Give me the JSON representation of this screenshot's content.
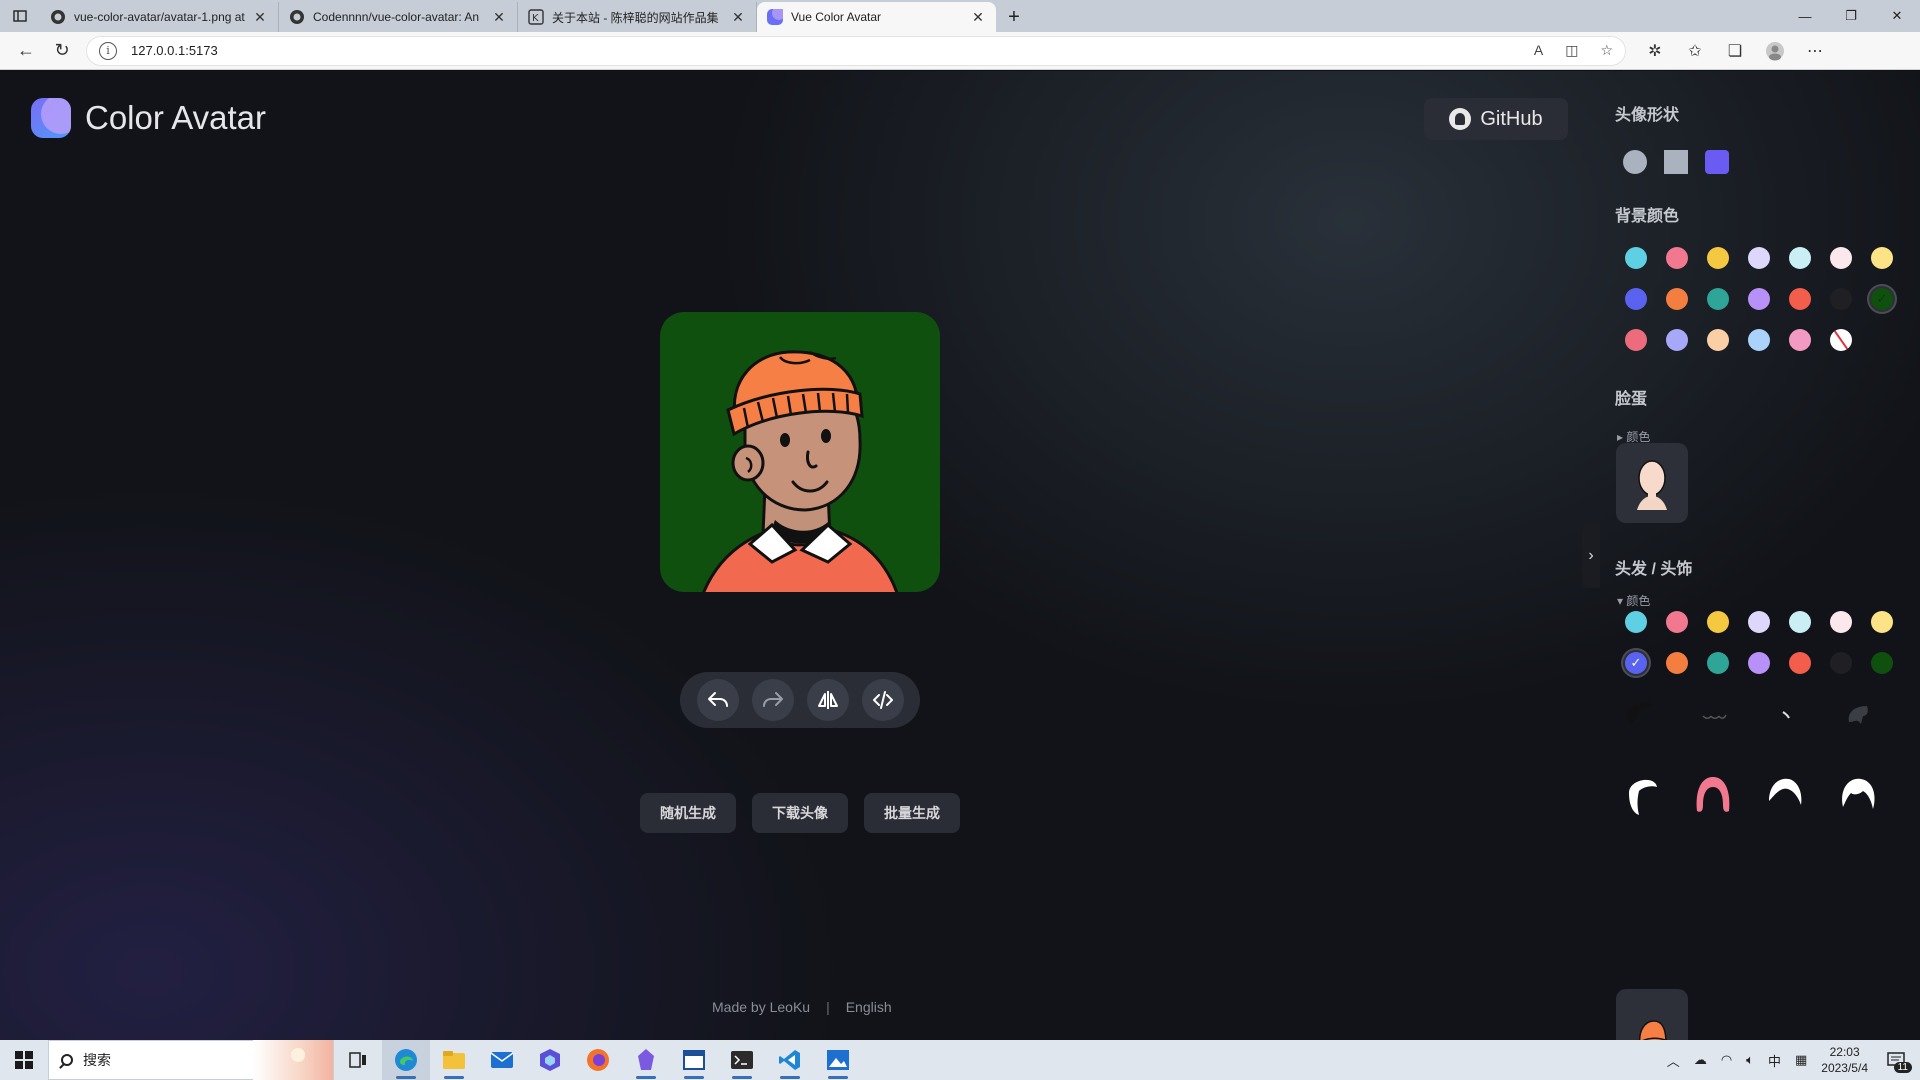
{
  "browser": {
    "tabs": [
      {
        "title": "vue-color-avatar/avatar-1.png at",
        "icon": "github-icon",
        "active": false
      },
      {
        "title": "Codennnn/vue-color-avatar: An",
        "icon": "github-icon",
        "active": false
      },
      {
        "title": "关于本站 - 陈梓聪的网站作品集",
        "icon": "k-icon",
        "active": false
      },
      {
        "title": "Vue Color Avatar",
        "icon": "vue-color-avatar-icon",
        "active": true
      }
    ],
    "url": "127.0.0.1:5173"
  },
  "app": {
    "logo_text": "Color Avatar",
    "github_label": "GitHub",
    "avatar_bg": "#0f500f",
    "actions": [
      "undo-icon",
      "redo-icon",
      "flip-icon",
      "code-icon"
    ],
    "buttons": [
      "随机生成",
      "下载头像",
      "批量生成"
    ],
    "footer": {
      "made_by": "Made by LeoKu",
      "separator": "|",
      "language": "English"
    }
  },
  "sidebar": {
    "shape_title": "头像形状",
    "shapes": [
      "circle",
      "square",
      "squircle"
    ],
    "selected_shape": "squircle",
    "bg_title": "背景颜色",
    "bg_colors": [
      "#5fd0e4",
      "#f2788f",
      "#f5c842",
      "#dcd7fb",
      "#c9eef4",
      "#fbe8ec",
      "#fce386",
      "#5a63f0",
      "#f47e40",
      "#2ea596",
      "#b791f7",
      "#f35d4c",
      "#202024",
      "#0f500f",
      "#ec6c7d",
      "#a7a9f8",
      "#fbcfa6",
      "#aad2fb",
      "#f39ac3",
      "none"
    ],
    "bg_selected": "#0f500f",
    "face_title": "脸蛋",
    "face_sub": "▸ 颜色",
    "hair_title": "头发 / 头饰",
    "hair_sub": "▾ 颜色",
    "hair_colors": [
      "#5fd0e4",
      "#f2788f",
      "#f5c842",
      "#dcd7fb",
      "#c9eef4",
      "#fbe8ec",
      "#fce386",
      "#5a63f0",
      "#f47e40",
      "#2ea596",
      "#b791f7",
      "#f35d4c",
      "#202024",
      "#0f500f"
    ],
    "hair_selected": "#5a63f0"
  },
  "taskbar": {
    "search_placeholder": "搜索",
    "ime": "中",
    "time": "22:03",
    "date": "2023/5/4",
    "notifications": "11"
  }
}
